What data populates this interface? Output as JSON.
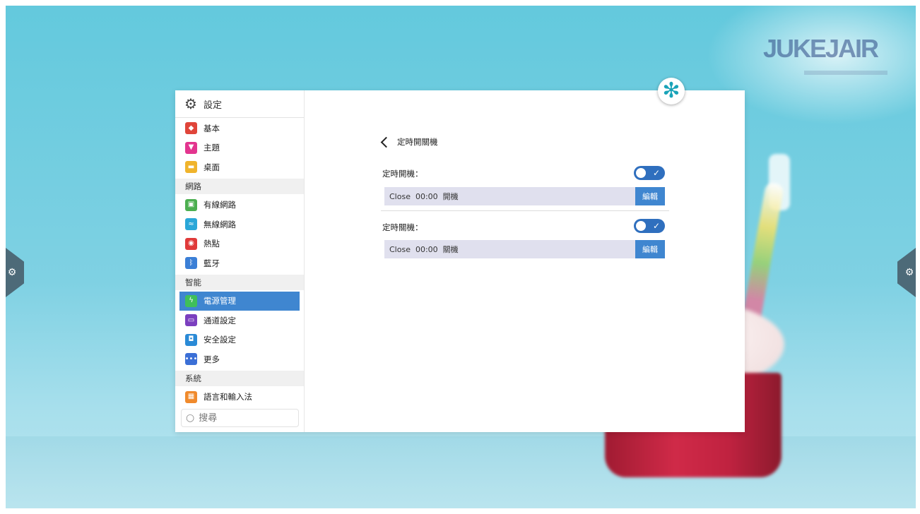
{
  "app": {
    "title": "設定",
    "title_icon": "gear-icon"
  },
  "sidebar": {
    "groups": [
      {
        "items": [
          {
            "label": "基本",
            "icon": "layers-icon",
            "color": "#e0453a"
          },
          {
            "label": "主題",
            "icon": "shirt-icon",
            "color": "#e3358f"
          },
          {
            "label": "桌面",
            "icon": "picture-icon",
            "color": "#f0b42c"
          }
        ]
      },
      {
        "section": "網路",
        "items": [
          {
            "label": "有線網路",
            "icon": "ethernet-icon",
            "color": "#4caf50"
          },
          {
            "label": "無線網路",
            "icon": "wifi-icon",
            "color": "#2aa7d8"
          },
          {
            "label": "熱點",
            "icon": "hotspot-icon",
            "color": "#e03a3a"
          },
          {
            "label": "藍牙",
            "icon": "bluetooth-icon",
            "color": "#3b7fd6"
          }
        ]
      },
      {
        "section": "智能",
        "items": [
          {
            "label": "電源管理",
            "icon": "lightning-icon",
            "color": "#3fbf5a",
            "active": true
          },
          {
            "label": "通道設定",
            "icon": "monitor-icon",
            "color": "#7b3fbf"
          },
          {
            "label": "安全設定",
            "icon": "shield-icon",
            "color": "#2a8ad6"
          },
          {
            "label": "更多",
            "icon": "more-icon",
            "color": "#3b6fd6"
          }
        ]
      },
      {
        "section": "系統",
        "items": [
          {
            "label": "語言和輸入法",
            "icon": "keyboard-icon",
            "color": "#f08a2c"
          }
        ]
      }
    ]
  },
  "search": {
    "placeholder": "搜尋"
  },
  "content": {
    "page_title": "定時開關機",
    "power_on": {
      "label": "定時開機：",
      "toggle_on": true,
      "schedule_text": "Close  00:00  開機",
      "edit_label": "編輯"
    },
    "power_off": {
      "label": "定時關機：",
      "toggle_on": true,
      "schedule_text": "Close  00:00  關機",
      "edit_label": "編輯"
    }
  },
  "desktop": {
    "logo_text": "JUKEJAIR"
  },
  "colors": {
    "accent": "#3f86d0",
    "toggle": "#2f6fbe",
    "schedule_bg": "#e0e0ee"
  }
}
